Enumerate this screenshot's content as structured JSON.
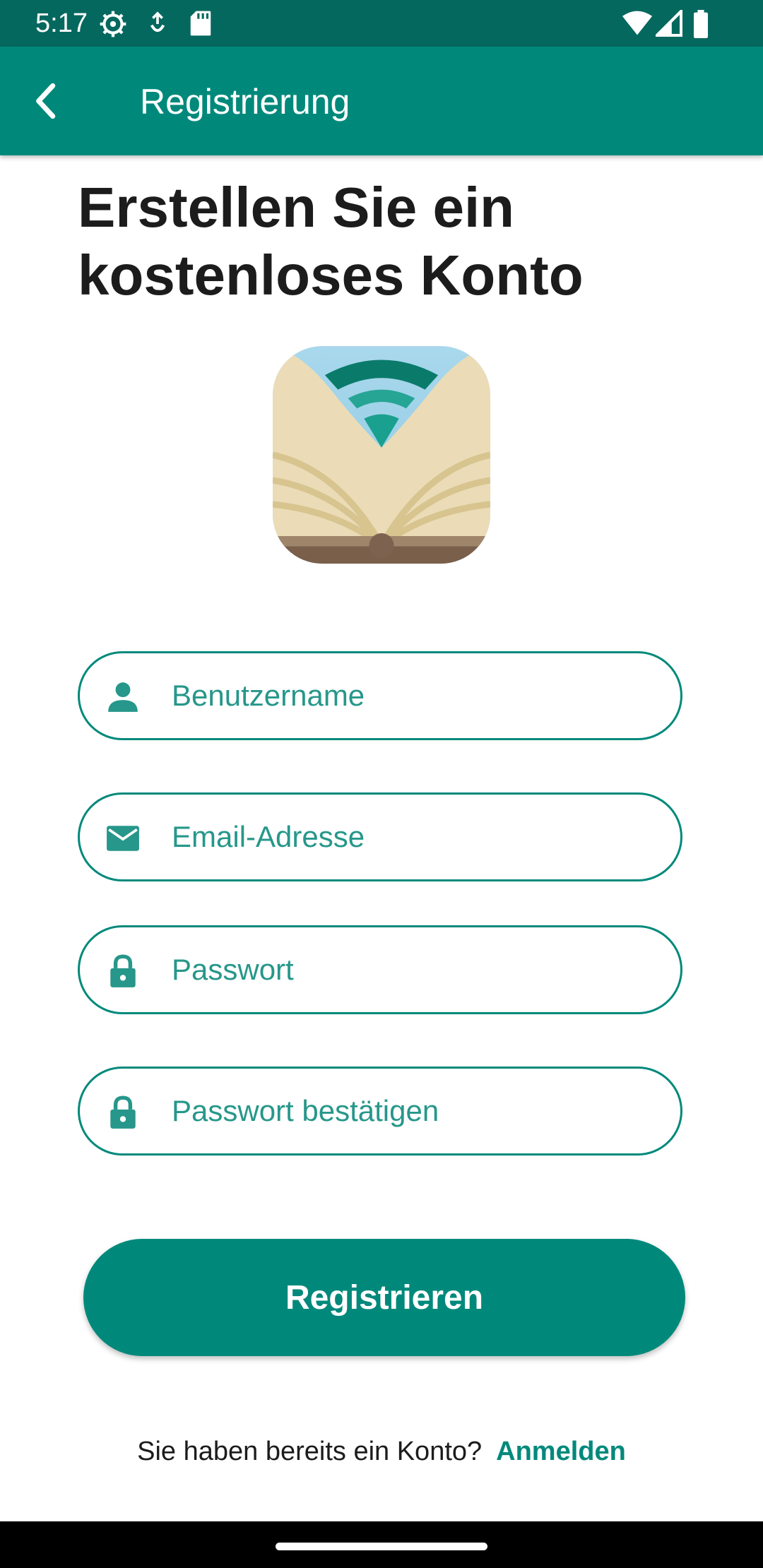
{
  "status_bar": {
    "time": "5:17",
    "left_icons": [
      "settings-icon",
      "usb-debug-icon",
      "sd-card-icon"
    ],
    "right_icons": [
      "wifi-icon",
      "signal-icon",
      "battery-icon"
    ]
  },
  "app_bar": {
    "title": "Registrierung",
    "back_icon": "chevron-left-icon"
  },
  "headline": "Erstellen Sie ein kostenloses Konto",
  "form": {
    "username": {
      "placeholder": "Benutzername",
      "value": "",
      "icon": "person-icon"
    },
    "email": {
      "placeholder": "Email-Adresse",
      "value": "",
      "icon": "mail-icon"
    },
    "password": {
      "placeholder": "Passwort",
      "value": "",
      "icon": "lock-icon"
    },
    "password_confirm": {
      "placeholder": "Passwort bestätigen",
      "value": "",
      "icon": "lock-icon"
    }
  },
  "register_button": "Registrieren",
  "login_prompt": {
    "question": "Sie haben bereits ein Konto?",
    "link": "Anmelden"
  },
  "colors": {
    "primary": "#00897b",
    "status_bar": "#05685f",
    "text_dark": "#1c1c1c"
  }
}
